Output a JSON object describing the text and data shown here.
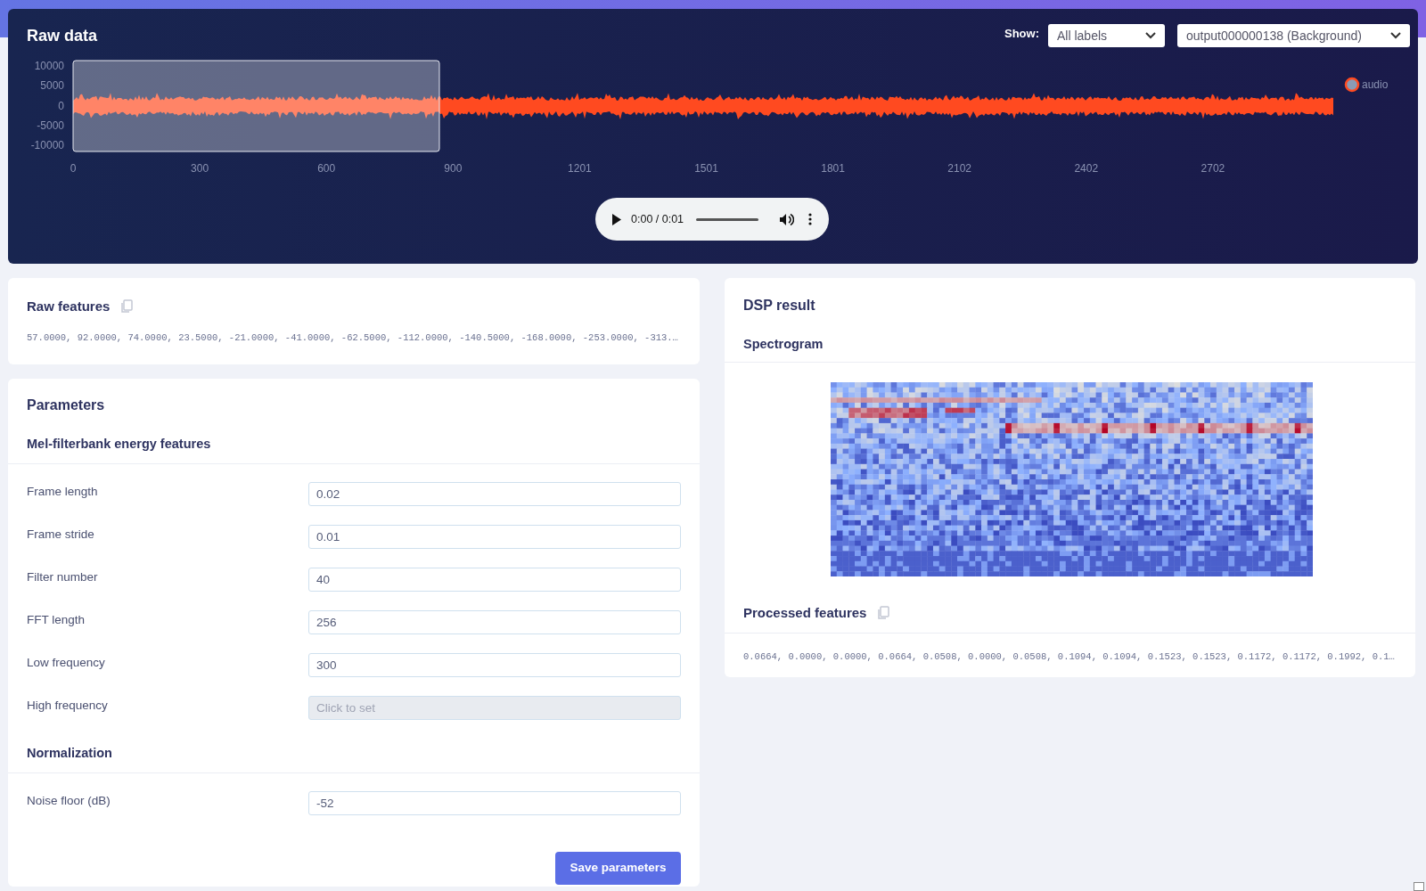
{
  "raw_data": {
    "title": "Raw data",
    "show_label": "Show:",
    "label_filter": "All labels",
    "sample_select": "output000000138 (Background)",
    "y_axis_labels": [
      "10000",
      "5000",
      "0",
      "-5000",
      "-10000"
    ],
    "x_axis_labels": [
      "0",
      "300",
      "600",
      "900",
      "1201",
      "1501",
      "1801",
      "2102",
      "2402",
      "2702"
    ],
    "legend": "audio",
    "audio_player": {
      "time": "0:00 / 0:01"
    }
  },
  "raw_features": {
    "title": "Raw features",
    "values": "57.0000, 92.0000, 74.0000, 23.5000, -21.0000, -41.0000, -62.5000, -112.0000, -140.5000, -168.0000, -253.0000, -313.…"
  },
  "parameters": {
    "title": "Parameters",
    "sections": [
      {
        "title": "Mel-filterbank energy features",
        "fields": [
          {
            "label": "Frame length",
            "value": "0.02",
            "disabled": false
          },
          {
            "label": "Frame stride",
            "value": "0.01",
            "disabled": false
          },
          {
            "label": "Filter number",
            "value": "40",
            "disabled": false
          },
          {
            "label": "FFT length",
            "value": "256",
            "disabled": false
          },
          {
            "label": "Low frequency",
            "value": "300",
            "disabled": false
          },
          {
            "label": "High frequency",
            "placeholder": "Click to set",
            "disabled": true
          }
        ]
      },
      {
        "title": "Normalization",
        "fields": [
          {
            "label": "Noise floor (dB)",
            "value": "-52",
            "disabled": false
          }
        ]
      }
    ],
    "save_button": "Save parameters"
  },
  "dsp_result": {
    "title": "DSP result",
    "spectrogram_title": "Spectrogram",
    "processed_features_title": "Processed features",
    "processed_values": "0.0664, 0.0000, 0.0000, 0.0664, 0.0508, 0.0000, 0.0508, 0.1094, 0.1094, 0.1523, 0.1523, 0.1172, 0.1172, 0.1992, 0.1…"
  }
}
